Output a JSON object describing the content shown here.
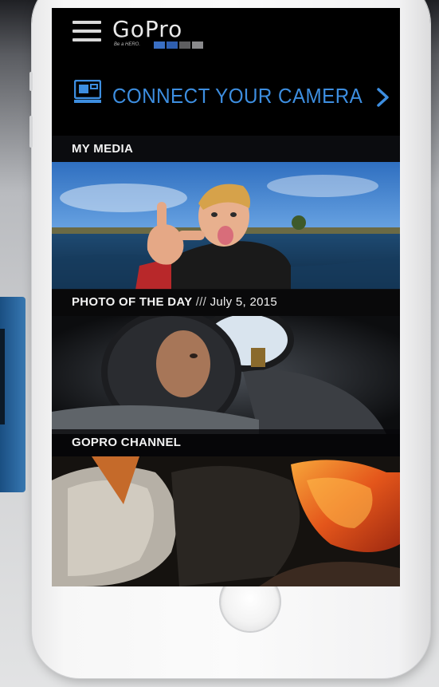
{
  "app": {
    "brand_name": "GoPro",
    "brand_tagline": "Be a HERO.",
    "brand_colors": [
      "#3a6fc4",
      "#2f5fb0",
      "#5e5e60",
      "#8a8a8c"
    ],
    "accent_color": "#3d8ee0"
  },
  "header": {
    "menu_icon": "hamburger-menu-icon"
  },
  "connect": {
    "icon": "camera-icon",
    "label": "CONNECT YOUR CAMERA",
    "chevron_icon": "chevron-right-icon"
  },
  "sections": [
    {
      "title": "MY MEDIA"
    },
    {
      "title": "PHOTO OF THE DAY",
      "separator": "///",
      "date": "July 5, 2015"
    },
    {
      "title": "GOPRO CHANNEL"
    }
  ]
}
